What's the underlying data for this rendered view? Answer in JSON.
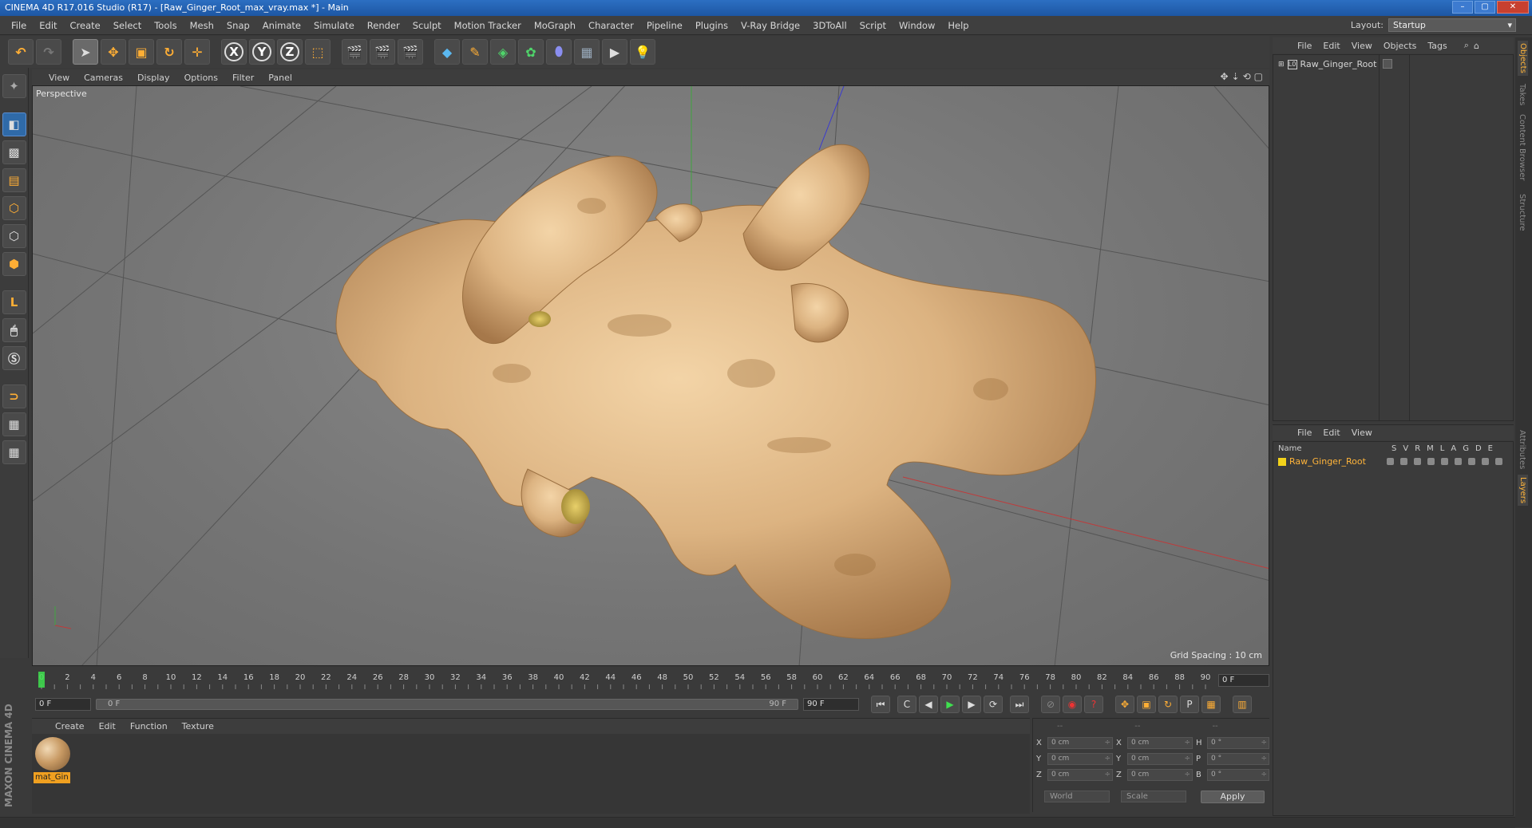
{
  "window": {
    "title": "CINEMA 4D R17.016 Studio (R17) - [Raw_Ginger_Root_max_vray.max *] - Main",
    "buttons": [
      "–",
      "▢",
      "✕"
    ]
  },
  "menubar": {
    "items": [
      "File",
      "Edit",
      "Create",
      "Select",
      "Tools",
      "Mesh",
      "Snap",
      "Animate",
      "Simulate",
      "Render",
      "Sculpt",
      "Motion Tracker",
      "MoGraph",
      "Character",
      "Pipeline",
      "Plugins",
      "V-Ray Bridge",
      "3DToAll",
      "Script",
      "Window",
      "Help"
    ],
    "layout_label": "Layout:",
    "layout_value": "Startup"
  },
  "toolbar": {
    "axis_x": "X",
    "axis_y": "Y",
    "axis_z": "Z"
  },
  "viewport": {
    "menu": [
      "View",
      "Cameras",
      "Display",
      "Options",
      "Filter",
      "Panel"
    ],
    "camera_label": "Perspective",
    "grid_spacing": "Grid Spacing : 10 cm"
  },
  "timeline": {
    "ticks": [
      "0",
      "2",
      "4",
      "6",
      "8",
      "10",
      "12",
      "14",
      "16",
      "18",
      "20",
      "22",
      "24",
      "26",
      "28",
      "30",
      "32",
      "34",
      "36",
      "38",
      "40",
      "42",
      "44",
      "46",
      "48",
      "50",
      "52",
      "54",
      "56",
      "58",
      "60",
      "62",
      "64",
      "66",
      "68",
      "70",
      "72",
      "74",
      "76",
      "78",
      "80",
      "82",
      "84",
      "86",
      "88",
      "90"
    ],
    "current_frame": "0 F",
    "start_field": "0 F",
    "slider_start": "0 F",
    "slider_end": "90 F",
    "end_field": "90 F"
  },
  "material_manager": {
    "menu": [
      "Create",
      "Edit",
      "Function",
      "Texture"
    ],
    "material_name": "mat_Gin"
  },
  "coordinates": {
    "header": [
      "--",
      "--",
      "--"
    ],
    "rows": [
      {
        "l1": "X",
        "v1": "0 cm",
        "l2": "X",
        "v2": "0 cm",
        "l3": "H",
        "v3": "0 °"
      },
      {
        "l1": "Y",
        "v1": "0 cm",
        "l2": "Y",
        "v2": "0 cm",
        "l3": "P",
        "v3": "0 °"
      },
      {
        "l1": "Z",
        "v1": "0 cm",
        "l2": "Z",
        "v2": "0 cm",
        "l3": "B",
        "v3": "0 °"
      }
    ],
    "space": "World",
    "mode": "Scale",
    "apply": "Apply"
  },
  "brand": {
    "text": "MAXON CINEMA 4D"
  },
  "object_manager": {
    "menu": [
      "File",
      "Edit",
      "View",
      "Objects",
      "Tags"
    ],
    "object_name": "Raw_Ginger_Root"
  },
  "layer_manager": {
    "menu": [
      "File",
      "Edit",
      "View"
    ],
    "col_name": "Name",
    "cols": [
      "S",
      "V",
      "R",
      "M",
      "L",
      "A",
      "G",
      "D",
      "E"
    ],
    "layer_name": "Raw_Ginger_Root",
    "layer_color": "#f2d21b"
  },
  "right_tabs": [
    "Objects",
    "Takes",
    "Content Browser",
    "Structure",
    "Attributes",
    "Layers"
  ]
}
